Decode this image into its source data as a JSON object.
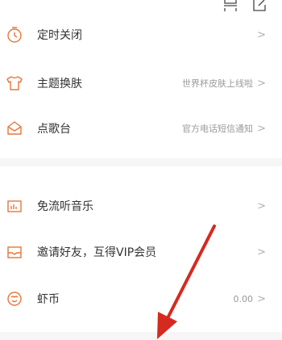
{
  "colors": {
    "accent": "#e8763a",
    "arrow": "#d52a1f",
    "text": "#333333",
    "hint": "#9a9a9a"
  },
  "top_bar": {
    "icons": [
      "scan-icon",
      "edit-icon"
    ]
  },
  "menu_group_1": [
    {
      "icon": "timer-icon",
      "label": "定时关闭",
      "hint": ""
    },
    {
      "icon": "tshirt-icon",
      "label": "主题换肤",
      "hint": "世界杯皮肤上线啦"
    },
    {
      "icon": "message-box-icon",
      "label": "点歌台",
      "hint": "官方电话短信通知"
    }
  ],
  "menu_group_2": [
    {
      "icon": "music-card-icon",
      "label": "免流听音乐",
      "hint": ""
    },
    {
      "icon": "gift-mail-icon",
      "label": "邀请好友，互得VIP会员",
      "hint": ""
    },
    {
      "icon": "coin-icon",
      "label": "虾币",
      "hint": "0.00"
    }
  ],
  "chevron": ">"
}
